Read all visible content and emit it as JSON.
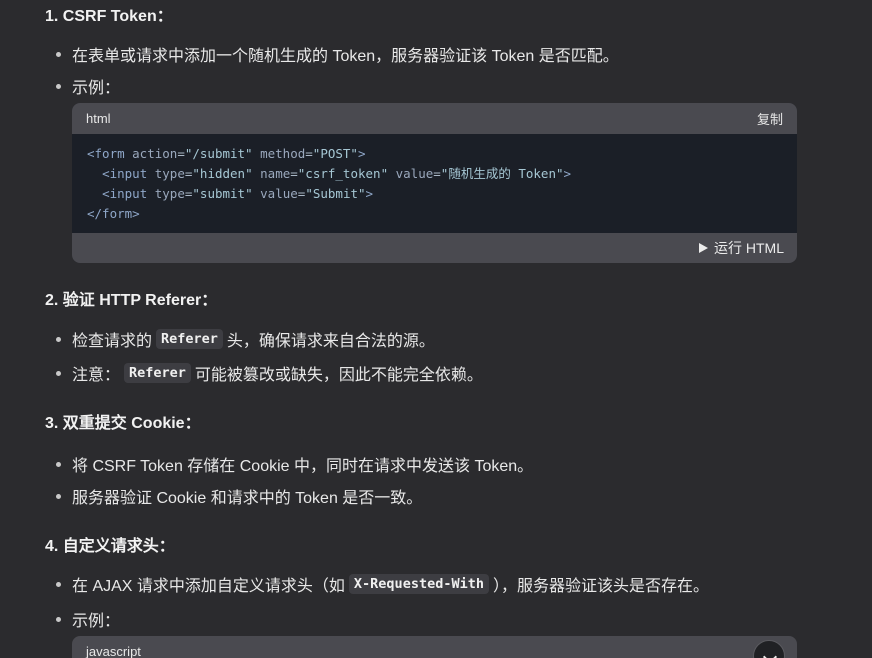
{
  "sections": [
    {
      "heading": "1. CSRF Token：",
      "items": [
        {
          "text": "在表单或请求中添加一个随机生成的 Token，服务器验证该 Token 是否匹配。"
        },
        {
          "text": "示例："
        }
      ]
    },
    {
      "heading": "2. 验证 HTTP Referer：",
      "items": [
        {
          "before": "检查请求的",
          "code": "Referer",
          "after": "头，确保请求来自合法的源。"
        },
        {
          "before": "注意：",
          "code": "Referer",
          "after": "可能被篡改或缺失，因此不能完全依赖。"
        }
      ]
    },
    {
      "heading": "3. 双重提交 Cookie：",
      "items": [
        {
          "text": "将 CSRF Token 存储在 Cookie 中，同时在请求中发送该 Token。"
        },
        {
          "text": "服务器验证 Cookie 和请求中的 Token 是否一致。"
        }
      ]
    },
    {
      "heading": "4. 自定义请求头：",
      "items": [
        {
          "before": "在 AJAX 请求中添加自定义请求头（如",
          "code": "X-Requested-With",
          "after": "），服务器验证该头是否存在。"
        },
        {
          "text": "示例："
        }
      ]
    }
  ],
  "code_block_html": {
    "language": "html",
    "copy_label": "复制",
    "run_label": "运行 HTML",
    "lines": [
      {
        "indent": "",
        "open": "<form ",
        "a1": "action",
        "v1": "\"/submit\"",
        "a2": "method",
        "v2": "\"POST\"",
        "a3": "",
        "v3": "",
        "close": ">"
      },
      {
        "indent": "  ",
        "open": "<input ",
        "a1": "type",
        "v1": "\"hidden\"",
        "a2": "name",
        "v2": "\"csrf_token\"",
        "a3": "value",
        "v3": "\"随机生成的 Token\"",
        "close": ">"
      },
      {
        "indent": "  ",
        "open": "<input ",
        "a1": "type",
        "v1": "\"submit\"",
        "a2": "value",
        "v2": "\"Submit\"",
        "a3": "",
        "v3": "",
        "close": ">"
      },
      {
        "indent": "",
        "open": "</form",
        "a1": "",
        "v1": "",
        "a2": "",
        "v2": "",
        "a3": "",
        "v3": "",
        "close": ">"
      }
    ]
  },
  "code_block_js": {
    "language": "javascript"
  },
  "icons": {
    "run": "play-icon",
    "scroll": "chevron-down-icon"
  },
  "colors": {
    "background": "#2b2b2e",
    "code_header": "#4a4a50",
    "code_body": "#1b1f27"
  }
}
